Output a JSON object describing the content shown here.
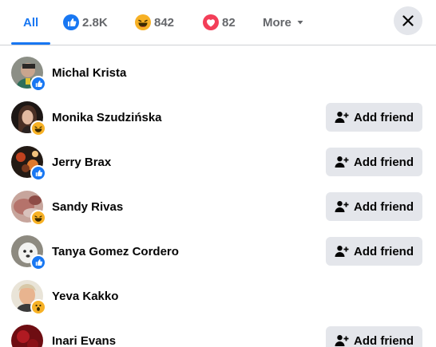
{
  "tabs": [
    {
      "label": "All",
      "count": "",
      "icon": "",
      "active": true
    },
    {
      "label": "",
      "count": "2.8K",
      "icon": "like-icon"
    },
    {
      "label": "",
      "count": "842",
      "icon": "haha-icon"
    },
    {
      "label": "",
      "count": "82",
      "icon": "love-icon"
    }
  ],
  "more_label": "More",
  "close_icon": "close-icon",
  "add_friend_label": "Add friend",
  "colors": {
    "accent": "#1877f2",
    "button_bg": "#e4e6eb",
    "secondary_text": "#65676b",
    "like": "#1877f2",
    "haha": "#f7b125",
    "love": "#f33e58"
  },
  "people": [
    {
      "name": "Michal Krista",
      "reaction": "like",
      "add_friend": false
    },
    {
      "name": "Monika Szudzińska",
      "reaction": "haha",
      "add_friend": true
    },
    {
      "name": "Jerry Brax",
      "reaction": "like",
      "add_friend": true
    },
    {
      "name": "Sandy Rivas",
      "reaction": "haha",
      "add_friend": true
    },
    {
      "name": "Tanya Gomez Cordero",
      "reaction": "like",
      "add_friend": true
    },
    {
      "name": "Yeva Kakko",
      "reaction": "wow",
      "add_friend": false
    },
    {
      "name": "Inari Evans",
      "reaction": "",
      "add_friend": true
    }
  ]
}
